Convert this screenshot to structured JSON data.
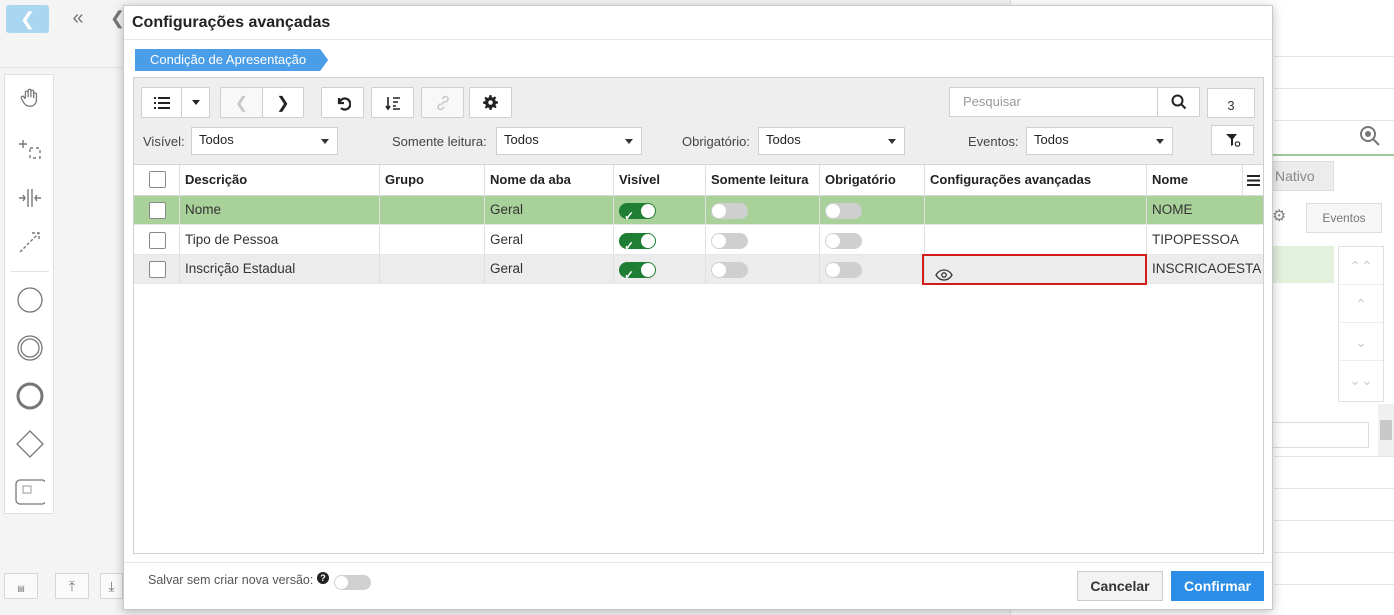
{
  "modal": {
    "title": "Configurações avançadas",
    "breadcrumb": "Condição de Apresentação"
  },
  "search": {
    "placeholder": "Pesquisar",
    "count": "3"
  },
  "filters": [
    {
      "label": "Visível:",
      "value": "Todos"
    },
    {
      "label": "Somente leitura:",
      "value": "Todos"
    },
    {
      "label": "Obrigatório:",
      "value": "Todos"
    },
    {
      "label": "Eventos:",
      "value": "Todos"
    }
  ],
  "table": {
    "columns": [
      "Descrição",
      "Grupo",
      "Nome da aba",
      "Visível",
      "Somente leitura",
      "Obrigatório",
      "Configurações avançadas",
      "Nome"
    ],
    "rows": [
      {
        "descricao": "Nome",
        "grupo": "",
        "aba": "Geral",
        "visivel": true,
        "somente_leitura": false,
        "obrigatorio": false,
        "config_icon": "",
        "nome": "NOME"
      },
      {
        "descricao": "Tipo de Pessoa",
        "grupo": "",
        "aba": "Geral",
        "visivel": true,
        "somente_leitura": false,
        "obrigatorio": false,
        "config_icon": "",
        "nome": "TIPOPESSOA"
      },
      {
        "descricao": "Inscrição Estadual",
        "grupo": "",
        "aba": "Geral",
        "visivel": true,
        "somente_leitura": false,
        "obrigatorio": false,
        "config_icon": "eye-icon",
        "nome": "INSCRICAOESTA"
      }
    ]
  },
  "footer": {
    "save_label": "Salvar sem criar nova versão:",
    "cancel": "Cancelar",
    "confirm": "Confirmar"
  },
  "background": {
    "tab_label": "Nativo",
    "eventos_label": "Eventos"
  },
  "colors": {
    "accent": "#2b8de6",
    "breadcrumb": "#4a9ee8",
    "selected_row": "#a9d19a",
    "toggle_on": "#1e7e34",
    "highlight": "#d21b1b"
  }
}
